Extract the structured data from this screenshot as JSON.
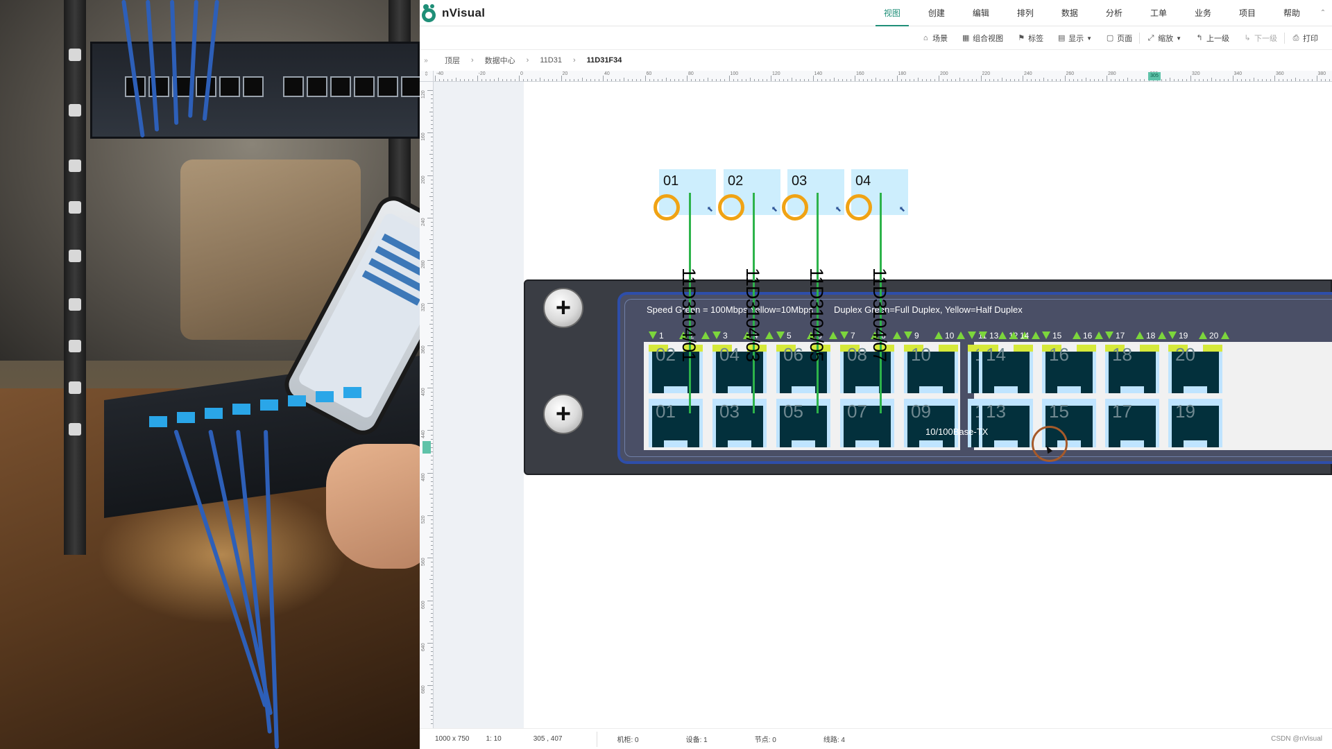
{
  "app": {
    "name": "nVisual"
  },
  "menu": {
    "items": [
      {
        "label": "视图",
        "active": true
      },
      {
        "label": "创建"
      },
      {
        "label": "编辑"
      },
      {
        "label": "排列"
      },
      {
        "label": "数据"
      },
      {
        "label": "分析"
      },
      {
        "label": "工单"
      },
      {
        "label": "业务"
      },
      {
        "label": "项目"
      },
      {
        "label": "帮助"
      }
    ],
    "collapse_glyph": "⌃"
  },
  "toolbar": {
    "items": [
      {
        "label": "场景",
        "icon": "scene-icon"
      },
      {
        "label": "组合视图",
        "icon": "combined-view-icon"
      },
      {
        "label": "标签",
        "icon": "tag-icon"
      },
      {
        "label": "显示",
        "icon": "display-icon",
        "dropdown": true
      },
      {
        "label": "页面",
        "icon": "page-icon"
      },
      {
        "label": "缩放",
        "icon": "zoom-icon",
        "dropdown": true
      },
      {
        "label": "上一级",
        "icon": "level-up-icon"
      },
      {
        "label": "下一级",
        "icon": "level-down-icon",
        "disabled": true
      },
      {
        "label": "打印",
        "icon": "print-icon"
      }
    ]
  },
  "breadcrumb": {
    "items": [
      "顶层",
      "数据中心",
      "11D31",
      "11D31F34"
    ],
    "expand_glyph": "»"
  },
  "ruler": {
    "h_labels": [
      "-40",
      "-20",
      "0",
      "20",
      "40",
      "60",
      "80",
      "100",
      "120",
      "140",
      "160",
      "180",
      "200",
      "220",
      "240",
      "260",
      "280",
      "300",
      "320",
      "340",
      "360",
      "380"
    ],
    "h_marker": "305",
    "v_labels": [
      "120",
      "160",
      "200",
      "240",
      "280",
      "320",
      "360",
      "400",
      "440",
      "480",
      "520",
      "560",
      "600",
      "640",
      "680"
    ],
    "corner_glyph": "⇕"
  },
  "patch_labels": [
    "01",
    "02",
    "03",
    "04"
  ],
  "vertical_labels": [
    "11D3104/01",
    "11D3104/03",
    "11D3104/05",
    "11D3104/07"
  ],
  "switch": {
    "speed_legend": "Speed Green = 100Mbps Yellow=10Mbps",
    "duplex_legend": "Duplex Green=Full Duplex, Yellow=Half Duplex",
    "model": "10/100Base-TX",
    "port_numbers_top": [
      "1",
      "2",
      "3",
      "4",
      "5",
      "6",
      "7",
      "8",
      "9",
      "10",
      "11",
      "12",
      "13",
      "14",
      "15",
      "16",
      "17",
      "18",
      "19",
      "20"
    ],
    "ports_top": [
      "02",
      "04",
      "06",
      "08",
      "10",
      "12",
      "14",
      "16",
      "18",
      "20"
    ],
    "ports_bottom": [
      "01",
      "03",
      "05",
      "07",
      "09",
      "11",
      "13",
      "15",
      "17",
      "19"
    ]
  },
  "status": {
    "page_size": "1000 x 750",
    "scale": "1: 10",
    "coords": "305 , 407",
    "cabinets": "机柜: 0",
    "devices": "设备: 1",
    "nodes": "节点: 0",
    "lines": "线路: 4",
    "watermark": "CSDN @nVisual"
  },
  "colors": {
    "accent": "#1f8f78",
    "ring": "#f0a314",
    "wire": "#2db34a",
    "label_bg": "#cdeefd",
    "port_body": "#03303c"
  }
}
